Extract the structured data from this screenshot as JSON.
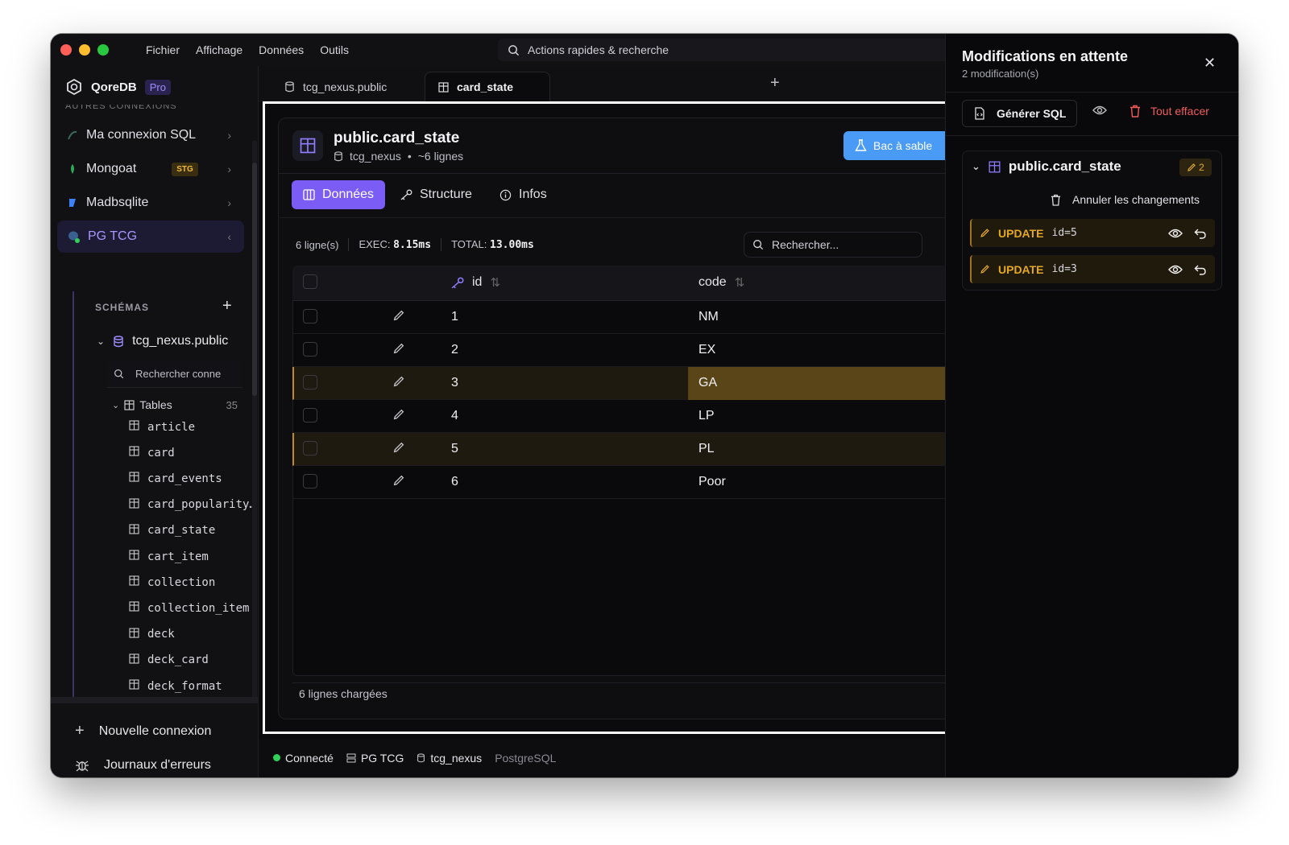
{
  "menu": {
    "items": [
      "Fichier",
      "Affichage",
      "Données",
      "Outils"
    ],
    "quick_search": "Actions rapides & recherche"
  },
  "sidebar": {
    "brand": "QoreDB",
    "badge": "Pro",
    "section_cut": "AUTRES CONNEXIONS",
    "connections": [
      {
        "label": "Ma connexion SQL",
        "icon": "mysql-icon"
      },
      {
        "label": "Mongoat",
        "icon": "mongodb-icon",
        "tag": "STG"
      },
      {
        "label": "Madbsqlite",
        "icon": "sqlite-icon"
      },
      {
        "label": "PG TCG",
        "icon": "postgres-icon",
        "active": true
      }
    ],
    "schemas_header": "SCHÉMAS",
    "schema": "tcg_nexus.public",
    "search_placeholder": "Rechercher conne",
    "tables_label": "Tables",
    "tables_count": "35",
    "tables": [
      "article",
      "card",
      "card_events",
      "card_popularity…",
      "card_state",
      "cart_item",
      "collection",
      "collection_item",
      "deck",
      "deck_card",
      "deck_format"
    ],
    "new_connection": "Nouvelle connexion",
    "error_logs": "Journaux d'erreurs"
  },
  "tabs": [
    {
      "label": "tcg_nexus.public",
      "active": false
    },
    {
      "label": "card_state",
      "active": true
    }
  ],
  "main": {
    "title": "public.card_state",
    "db": "tcg_nexus",
    "bullet": "•",
    "row_estimate": "~6 lignes",
    "sandbox": "Bac à sable",
    "subtabs": [
      "Données",
      "Structure",
      "Infos"
    ],
    "stats": {
      "rows": "6 ligne(s)",
      "exec_label": "EXEC:",
      "exec_value": "8.15ms",
      "total_label": "TOTAL:",
      "total_value": "13.00ms"
    },
    "search_placeholder": "Rechercher...",
    "columns": [
      "id",
      "code"
    ],
    "rows": [
      {
        "id": "1",
        "code": "NM",
        "modified": false
      },
      {
        "id": "2",
        "code": "EX",
        "modified": false
      },
      {
        "id": "3",
        "code": "GA",
        "modified": true
      },
      {
        "id": "4",
        "code": "LP",
        "modified": false
      },
      {
        "id": "5",
        "code": "PL",
        "modified": true
      },
      {
        "id": "6",
        "code": "Poor",
        "modified": false
      }
    ],
    "loaded": "6 lignes chargées"
  },
  "status": {
    "connected": "Connecté",
    "connection": "PG TCG",
    "database": "tcg_nexus",
    "engine": "PostgreSQL"
  },
  "pending": {
    "title": "Modifications en attente",
    "subtitle": "2 modification(s)",
    "generate_sql": "Générer SQL",
    "clear_all": "Tout effacer",
    "table": "public.card_state",
    "count": "2",
    "revert": "Annuler les changements",
    "changes": [
      {
        "op": "UPDATE",
        "pk": "id=5"
      },
      {
        "op": "UPDATE",
        "pk": "id=3"
      }
    ]
  },
  "colors": {
    "accent": "#7b5cf5",
    "modified": "#e5a823",
    "danger": "#f25b5b",
    "connected": "#2fd15a",
    "sandbox": "#4a9bf5"
  }
}
